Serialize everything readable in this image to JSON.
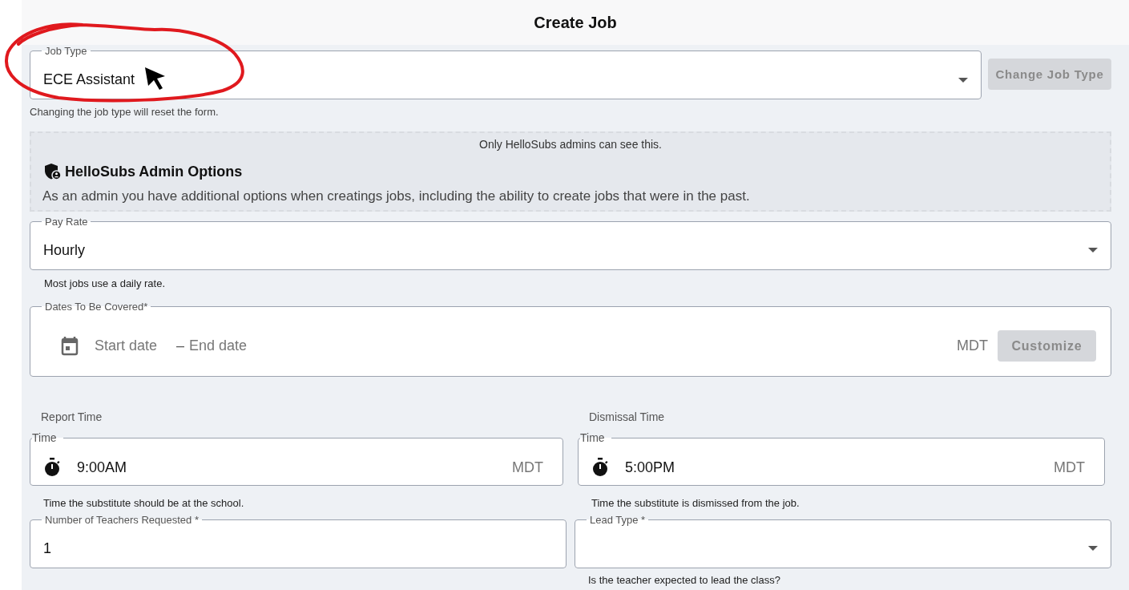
{
  "header": {
    "title": "Create Job"
  },
  "job_type": {
    "label": "Job Type",
    "value": "ECE Assistant",
    "helper": "Changing the job type will reset the form.",
    "button": {
      "label": "Change Job Type",
      "disabled": true
    }
  },
  "admin_notice": {
    "visibility_note": "Only HelloSubs admins can see this.",
    "title": "HelloSubs Admin Options",
    "description": "As an admin you have additional options when creatings jobs, including the ability to create jobs that were in the past."
  },
  "pay_rate": {
    "label": "Pay Rate",
    "value": "Hourly",
    "helper": "Most jobs use a daily rate."
  },
  "dates": {
    "label": "Dates To Be Covered*",
    "start_placeholder": "Start date",
    "separator": "–",
    "end_placeholder": "End date",
    "timezone": "MDT",
    "button": {
      "label": "Customize",
      "disabled": true
    }
  },
  "times": [
    {
      "heading": "Report Time",
      "label": "Time",
      "value": "9:00AM",
      "timezone": "MDT",
      "helper": "Time the substitute should be at the school."
    },
    {
      "heading": "Dismissal Time",
      "label": "Time",
      "value": "5:00PM",
      "timezone": "MDT",
      "helper": "Time the substitute is dismissed from the job."
    }
  ],
  "teachers": {
    "label": "Number of Teachers Requested *",
    "value": "1"
  },
  "lead_type": {
    "label": "Lead Type *",
    "helper": "Is the teacher expected to lead the class?"
  }
}
